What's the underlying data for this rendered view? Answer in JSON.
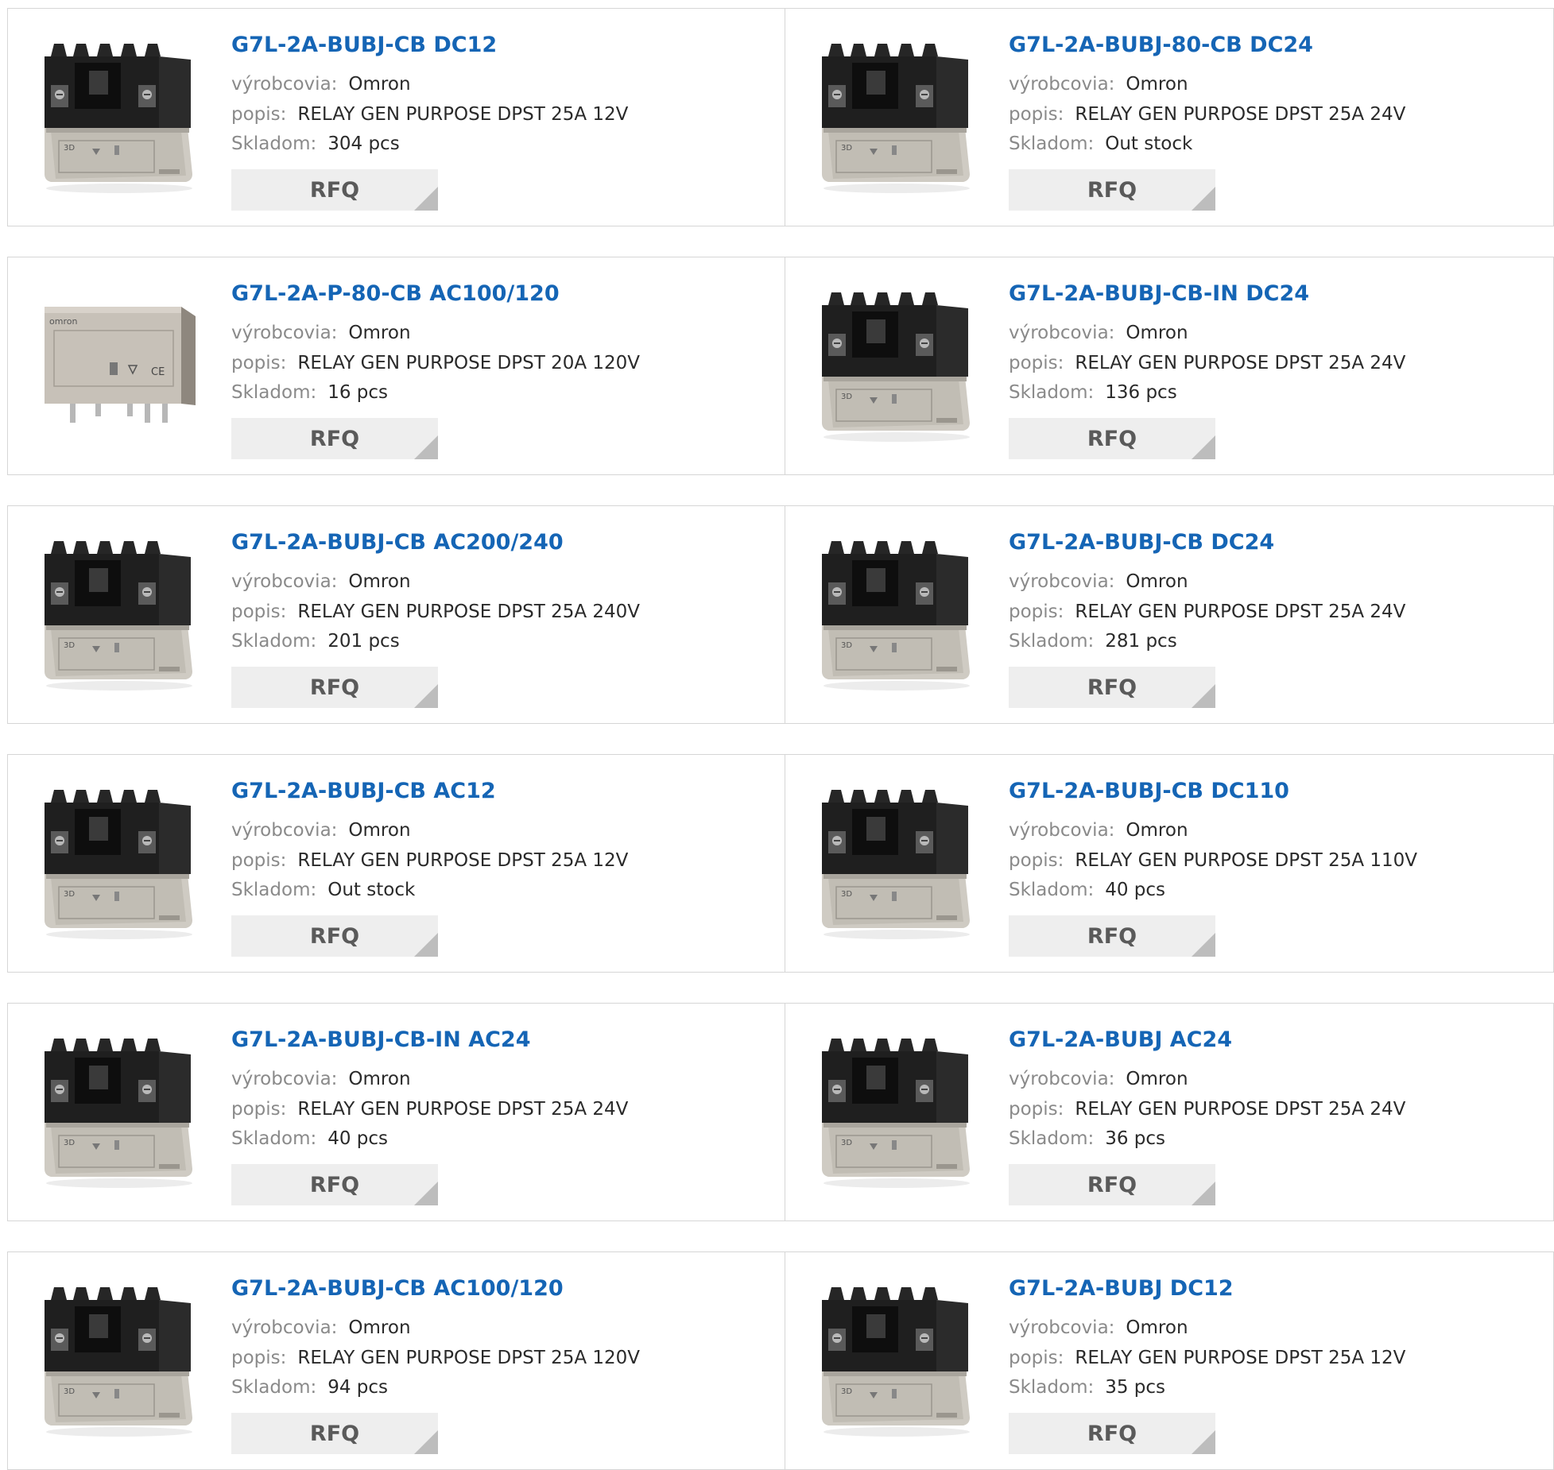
{
  "labels": {
    "manufacturer": "výrobcovia:",
    "description": "popis:",
    "stock": "Skladom:",
    "rfq": "RFQ"
  },
  "products": [
    {
      "title": "G7L-2A-BUBJ-CB DC12",
      "manufacturer": "Omron",
      "description": "RELAY GEN PURPOSE DPST 25A 12V",
      "stock": "304 pcs",
      "image": "relay-black-top"
    },
    {
      "title": "G7L-2A-BUBJ-80-CB DC24",
      "manufacturer": "Omron",
      "description": "RELAY GEN PURPOSE DPST 25A 24V",
      "stock": "Out stock",
      "image": "relay-black-top"
    },
    {
      "title": "G7L-2A-P-80-CB AC100/120",
      "manufacturer": "Omron",
      "description": "RELAY GEN PURPOSE DPST 20A 120V",
      "stock": "16 pcs",
      "image": "relay-box-pcb"
    },
    {
      "title": "G7L-2A-BUBJ-CB-IN DC24",
      "manufacturer": "Omron",
      "description": "RELAY GEN PURPOSE DPST 25A 24V",
      "stock": "136 pcs",
      "image": "relay-black-top"
    },
    {
      "title": "G7L-2A-BUBJ-CB AC200/240",
      "manufacturer": "Omron",
      "description": "RELAY GEN PURPOSE DPST 25A 240V",
      "stock": "201 pcs",
      "image": "relay-black-top"
    },
    {
      "title": "G7L-2A-BUBJ-CB DC24",
      "manufacturer": "Omron",
      "description": "RELAY GEN PURPOSE DPST 25A 24V",
      "stock": "281 pcs",
      "image": "relay-black-top"
    },
    {
      "title": "G7L-2A-BUBJ-CB AC12",
      "manufacturer": "Omron",
      "description": "RELAY GEN PURPOSE DPST 25A 12V",
      "stock": "Out stock",
      "image": "relay-black-top"
    },
    {
      "title": "G7L-2A-BUBJ-CB DC110",
      "manufacturer": "Omron",
      "description": "RELAY GEN PURPOSE DPST 25A 110V",
      "stock": "40 pcs",
      "image": "relay-black-top"
    },
    {
      "title": "G7L-2A-BUBJ-CB-IN AC24",
      "manufacturer": "Omron",
      "description": "RELAY GEN PURPOSE DPST 25A 24V",
      "stock": "40 pcs",
      "image": "relay-black-top"
    },
    {
      "title": "G7L-2A-BUBJ AC24",
      "manufacturer": "Omron",
      "description": "RELAY GEN PURPOSE DPST 25A 24V",
      "stock": "36 pcs",
      "image": "relay-black-top"
    },
    {
      "title": "G7L-2A-BUBJ-CB AC100/120",
      "manufacturer": "Omron",
      "description": "RELAY GEN PURPOSE DPST 25A 120V",
      "stock": "94 pcs",
      "image": "relay-black-top"
    },
    {
      "title": "G7L-2A-BUBJ DC12",
      "manufacturer": "Omron",
      "description": "RELAY GEN PURPOSE DPST 25A 12V",
      "stock": "35 pcs",
      "image": "relay-black-top"
    }
  ],
  "box_image_text": {
    "brand": "omron",
    "mark": "CE"
  },
  "colors": {
    "title": "#1565b5",
    "label": "#8a8a8a",
    "value": "#2a2a2a",
    "rfq_bg": "#eeeeee",
    "border": "#d6d6d6"
  }
}
